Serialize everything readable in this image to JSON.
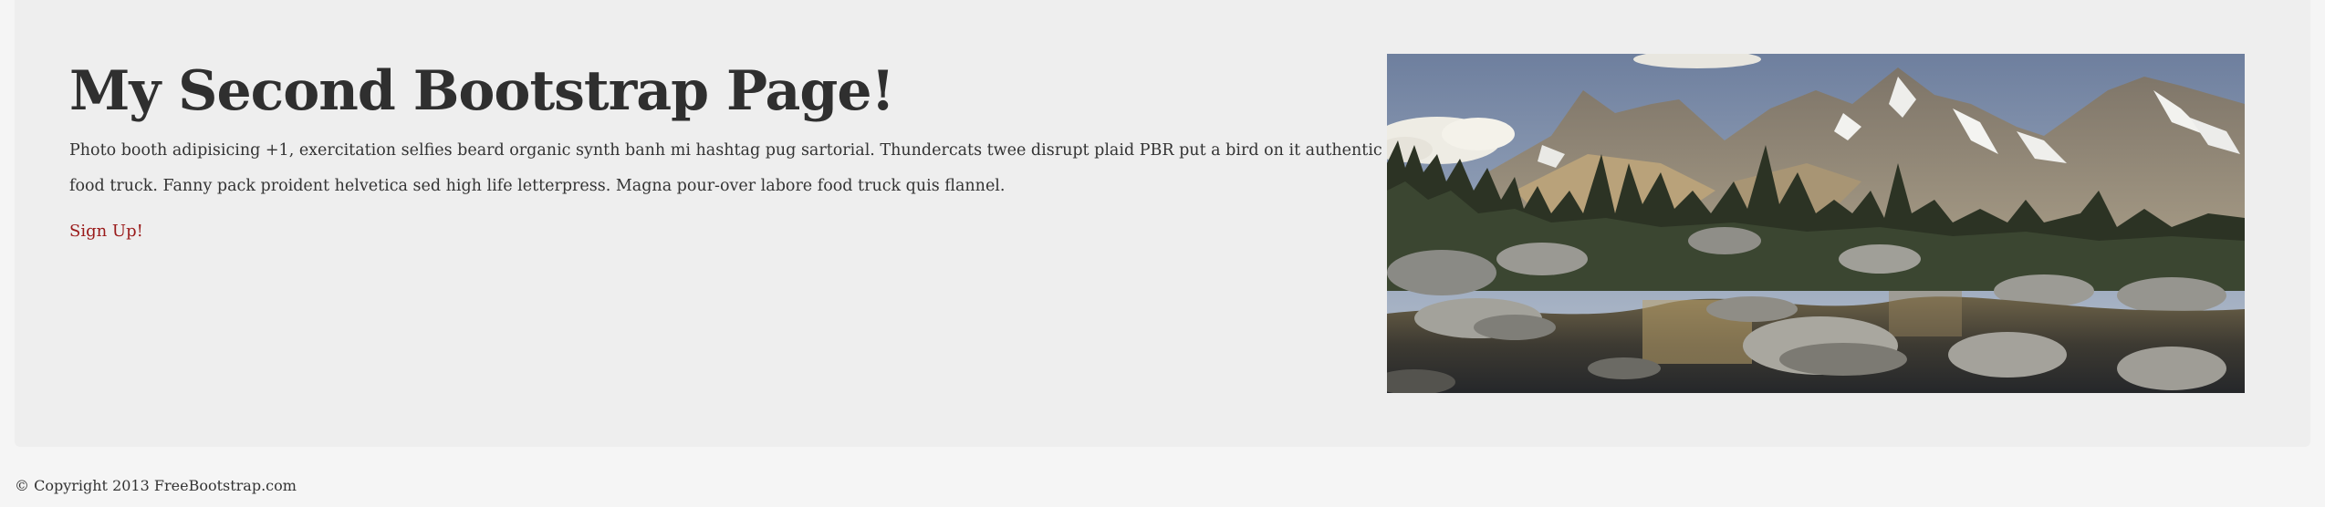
{
  "hero": {
    "title": "My Second Bootstrap Page!",
    "description": "Photo booth adipisicing +1, exercitation selfies beard organic synth banh mi hashtag pug sartorial. Thundercats twee disrupt plaid PBR put a bird on it authentic food truck. Fanny pack proident helvetica sed high life letterpress. Magna pour-over labore food truck quis flannel.",
    "signup_label": "Sign Up!"
  },
  "footer": {
    "copyright": "© Copyright 2013 FreeBootstrap.com"
  },
  "colors": {
    "page_background": "#f5f5f5",
    "jumbotron_background": "#eeeeee",
    "link": "#9a1a1a",
    "text": "#333333"
  }
}
